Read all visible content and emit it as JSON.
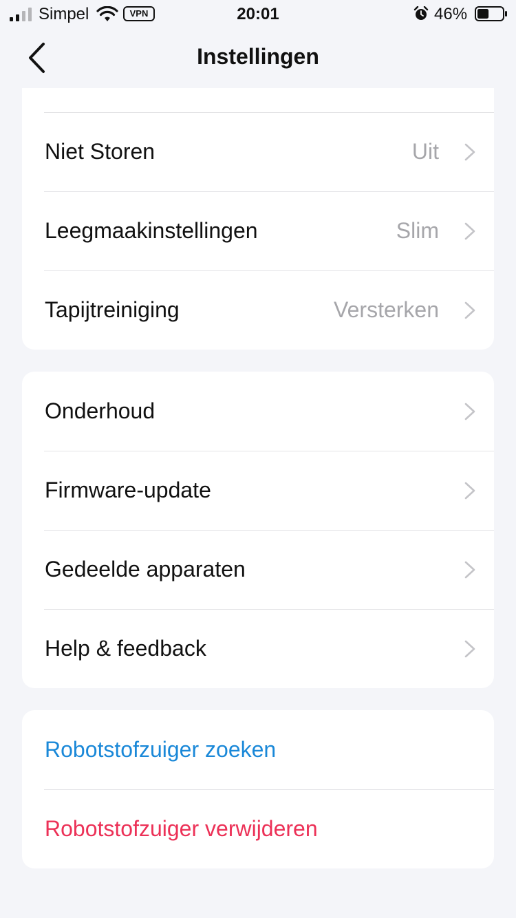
{
  "status_bar": {
    "carrier": "Simpel",
    "vpn": "VPN",
    "time": "20:01",
    "battery_percent": "46%",
    "battery_level": 0.46,
    "icons": [
      "signal-icon",
      "wifi-icon",
      "alarm-icon",
      "battery-icon"
    ]
  },
  "nav": {
    "title": "Instellingen",
    "back_icon": "chevron-left-icon"
  },
  "group1": {
    "items": [
      {
        "label": "Niet Storen",
        "value": "Uit"
      },
      {
        "label": "Leegmaakinstellingen",
        "value": "Slim"
      },
      {
        "label": "Tapijtreiniging",
        "value": "Versterken"
      }
    ]
  },
  "group2": {
    "items": [
      {
        "label": "Onderhoud"
      },
      {
        "label": "Firmware-update"
      },
      {
        "label": "Gedeelde apparaten"
      },
      {
        "label": "Help & feedback"
      }
    ]
  },
  "group3": {
    "items": [
      {
        "label": "Robotstofzuiger zoeken",
        "color": "#1a88d8"
      },
      {
        "label": "Robotstofzuiger verwijderen",
        "color": "#ec3157"
      }
    ]
  },
  "colors": {
    "background": "#f4f5f9",
    "card": "#ffffff",
    "secondary_text": "#a6a6aa",
    "chevron": "#c4c4c8",
    "action_blue": "#1a88d8",
    "action_red": "#ec3157"
  }
}
